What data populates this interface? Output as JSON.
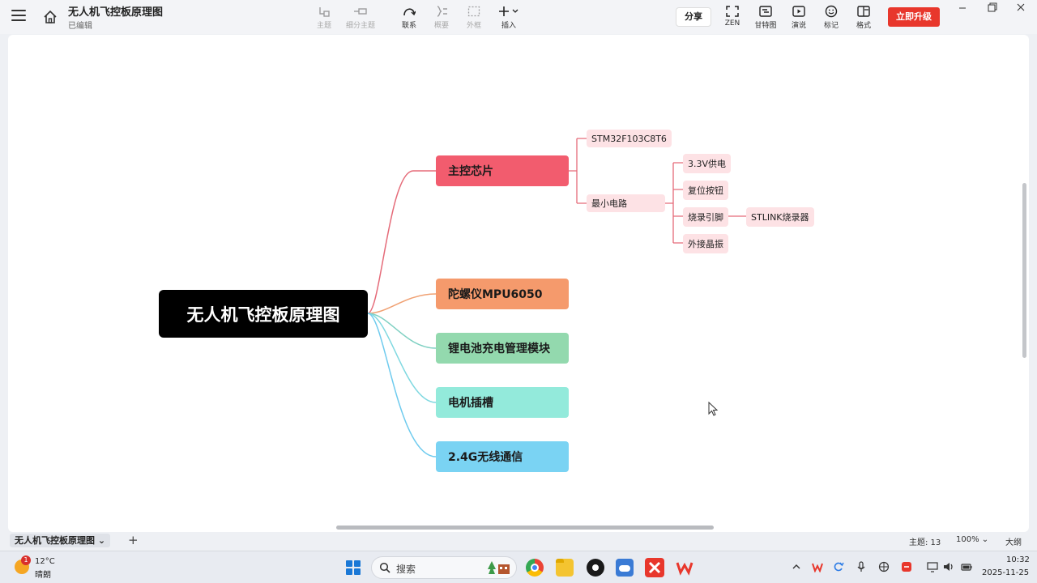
{
  "window": {
    "title": "无人机飞控板原理图",
    "status": "已编辑"
  },
  "toolbar": {
    "items": [
      {
        "label": "主题",
        "icon": "topic-icon",
        "enabled": false
      },
      {
        "label": "细分主题",
        "icon": "subtopic-icon",
        "enabled": false
      },
      {
        "label": "联系",
        "icon": "relation-icon",
        "enabled": true
      },
      {
        "label": "概要",
        "icon": "summary-icon",
        "enabled": false
      },
      {
        "label": "外框",
        "icon": "boundary-icon",
        "enabled": false
      },
      {
        "label": "插入",
        "icon": "plus-icon",
        "enabled": true
      }
    ],
    "share_label": "分享",
    "right_items": [
      {
        "label": "ZEN",
        "icon": "fullscreen-icon"
      },
      {
        "label": "甘特图",
        "icon": "gantt-icon"
      },
      {
        "label": "演说",
        "icon": "play-icon"
      },
      {
        "label": "标记",
        "icon": "smiley-icon"
      },
      {
        "label": "格式",
        "icon": "format-panel-icon"
      }
    ],
    "upgrade_label": "立即升级"
  },
  "mindmap": {
    "root": "无人机飞控板原理图",
    "branches": [
      {
        "label": "主控芯片",
        "color": "#f25c6e",
        "line": "#e56b79"
      },
      {
        "label": "陀螺仪MPU6050",
        "color": "#f59a6c",
        "line": "#f0a173"
      },
      {
        "label": "锂电池充电管理模块",
        "color": "#93d9ae",
        "line": "#7fd0c2"
      },
      {
        "label": "电机插槽",
        "color": "#93eadb",
        "line": "#7fd8e0"
      },
      {
        "label": "2.4G无线通信",
        "color": "#7ad3f3",
        "line": "#6fcbee"
      }
    ],
    "chip_children": [
      "STM32F103C8T6",
      "最小电路"
    ],
    "circuit_children": [
      "3.3V供电",
      "复位按钮",
      "烧录引脚",
      "外接晶振"
    ],
    "pin_children": [
      "STLINK烧录器"
    ]
  },
  "statusbar": {
    "sheet": "无人机飞控板原理图",
    "topics": "主题: 13",
    "zoom": "100%",
    "outline": "大纲"
  },
  "taskbar": {
    "temperature": "12°C",
    "weather": "晴朗",
    "weather_badge": "1",
    "search_placeholder": "搜索",
    "time": "10:32",
    "date": "2025-11-25"
  }
}
